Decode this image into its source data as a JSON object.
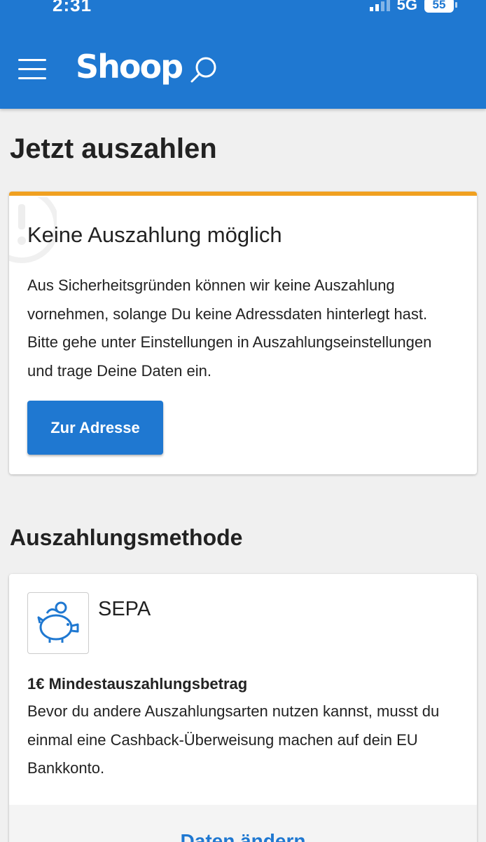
{
  "status_bar": {
    "time": "2:31",
    "network": "5G",
    "battery": "55"
  },
  "header": {
    "logo": "Shoop",
    "menu_icon": "hamburger-menu-icon",
    "search_icon": "search-icon"
  },
  "page": {
    "title": "Jetzt auszahlen"
  },
  "warning": {
    "icon": "alert-circle-icon",
    "accent_color": "#f0a020",
    "title": "Keine Auszahlung möglich",
    "text": "Aus Sicherheitsgründen können wir keine Auszahlung vornehmen, solange Du keine Adressdaten hinterlegt hast. Bitte gehe unter Einstellungen in Auszahlungseinstellungen und trage Deine Daten ein.",
    "button_label": "Zur Adresse"
  },
  "methods": {
    "section_title": "Auszahlungsmethode",
    "items": [
      {
        "icon": "piggy-bank-icon",
        "name": "SEPA",
        "minimum": "1€ Mindestauszahlungsbetrag",
        "description": "Bevor du andere Auszahlungsarten nutzen kannst, musst du einmal eine Cashback-Überweisung machen auf dein EU Bankkonto.",
        "action_label": "Daten ändern"
      }
    ]
  },
  "colors": {
    "brand_blue": "#1f78d1",
    "warning_orange": "#f0a020",
    "background": "#f0f0f0"
  }
}
